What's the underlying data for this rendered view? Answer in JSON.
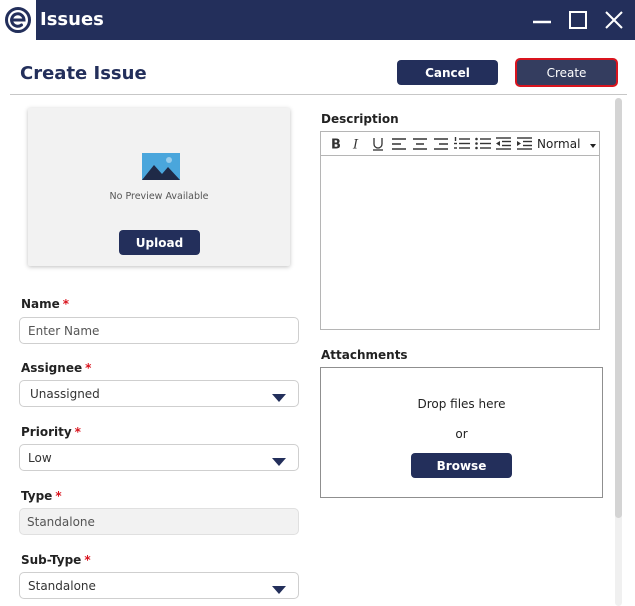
{
  "window": {
    "title": "Issues",
    "logo_icon": "e-logo-icon",
    "controls": [
      "minimize-icon",
      "maximize-icon",
      "close-icon"
    ]
  },
  "header": {
    "title": "Create Issue",
    "cancel_label": "Cancel",
    "create_label": "Create"
  },
  "preview": {
    "text": "No Preview Available",
    "upload_label": "Upload",
    "icon": "image-icon"
  },
  "form": {
    "name": {
      "label": "Name",
      "required": "*",
      "value": "",
      "placeholder": "Enter Name"
    },
    "assignee": {
      "label": "Assignee",
      "required": "*",
      "value": "Unassigned"
    },
    "priority": {
      "label": "Priority",
      "required": "*",
      "value": "Low"
    },
    "type": {
      "label": "Type",
      "required": "*",
      "value": "Standalone"
    },
    "subtype": {
      "label": "Sub-Type",
      "required": "*",
      "value": "Standalone"
    }
  },
  "description": {
    "label": "Description",
    "toolbar": [
      "bold-icon",
      "italic-icon",
      "underline-icon",
      "align-left-icon",
      "align-center-icon",
      "align-right-icon",
      "ordered-list-icon",
      "bullet-list-icon",
      "outdent-icon",
      "indent-icon"
    ],
    "format_value": "Normal",
    "content": ""
  },
  "attachments": {
    "label": "Attachments",
    "drop_text": "Drop files here",
    "or_text": "or",
    "browse_label": "Browse"
  },
  "colors": {
    "primary": "#232f5b",
    "required": "#d9141e",
    "create_outline": "#d9141e"
  }
}
